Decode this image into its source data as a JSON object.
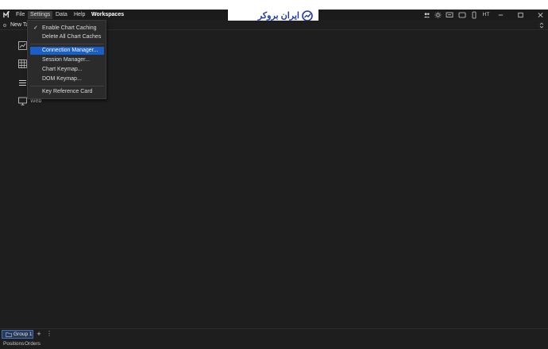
{
  "banner": {
    "text": "ایران بروکر"
  },
  "menubar": {
    "items": [
      {
        "label": "File"
      },
      {
        "label": "Settings"
      },
      {
        "label": "Data"
      },
      {
        "label": "Help"
      },
      {
        "label": "Workspaces"
      }
    ]
  },
  "window_controls": {
    "user_initials": "HT"
  },
  "tabs": [
    {
      "label": "New Tab"
    }
  ],
  "sidebar": {
    "items": [
      {
        "icon": "chart-icon",
        "label": ""
      },
      {
        "icon": "grid-icon",
        "label": ""
      },
      {
        "icon": "list-icon",
        "label": ""
      },
      {
        "icon": "monitor-icon",
        "label": "Web"
      }
    ]
  },
  "settings_menu": {
    "items": [
      {
        "label": "Enable Chart Caching",
        "checked": true
      },
      {
        "label": "Delete All Chart Caches"
      },
      {
        "label": "Connection Manager..."
      },
      {
        "label": "Session Manager..."
      },
      {
        "label": "Chart Keymap..."
      },
      {
        "label": "DOM Keymap..."
      },
      {
        "label": "Key Reference Card"
      }
    ],
    "check_mark": "✓"
  },
  "bottom": {
    "group_label": "Group 1",
    "add_symbol": "+",
    "more_symbol": "⋮",
    "panels": [
      {
        "label": "Positions"
      },
      {
        "label": "Orders"
      }
    ]
  },
  "colors": {
    "background": "#1e1e1e",
    "menu_highlight": "#1a5fc7",
    "banner_text": "#1f3aa8"
  }
}
